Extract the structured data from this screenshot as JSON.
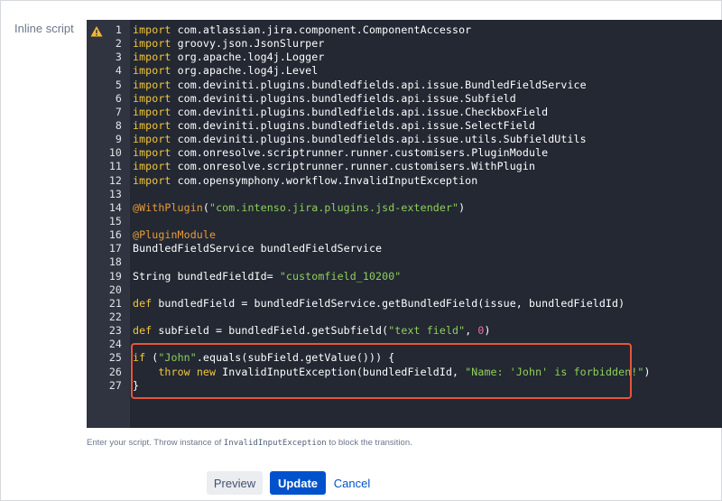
{
  "field": {
    "label": "Inline script"
  },
  "editor": {
    "warning_icon": "warning-triangle-icon",
    "lines": [
      {
        "n": "1",
        "parts": [
          {
            "t": "import",
            "c": "kw"
          },
          {
            "t": " com.atlassian.jira.component.ComponentAccessor",
            "c": ""
          }
        ]
      },
      {
        "n": "2",
        "parts": [
          {
            "t": "import",
            "c": "kw"
          },
          {
            "t": " groovy.json.JsonSlurper",
            "c": ""
          }
        ]
      },
      {
        "n": "3",
        "parts": [
          {
            "t": "import",
            "c": "kw"
          },
          {
            "t": " org.apache.log4j.Logger",
            "c": ""
          }
        ]
      },
      {
        "n": "4",
        "parts": [
          {
            "t": "import",
            "c": "kw"
          },
          {
            "t": " org.apache.log4j.Level",
            "c": ""
          }
        ]
      },
      {
        "n": "5",
        "parts": [
          {
            "t": "import",
            "c": "kw"
          },
          {
            "t": " com.deviniti.plugins.bundledfields.api.issue.BundledFieldService",
            "c": ""
          }
        ]
      },
      {
        "n": "6",
        "parts": [
          {
            "t": "import",
            "c": "kw"
          },
          {
            "t": " com.deviniti.plugins.bundledfields.api.issue.Subfield",
            "c": ""
          }
        ]
      },
      {
        "n": "7",
        "parts": [
          {
            "t": "import",
            "c": "kw"
          },
          {
            "t": " com.deviniti.plugins.bundledfields.api.issue.CheckboxField",
            "c": ""
          }
        ]
      },
      {
        "n": "8",
        "parts": [
          {
            "t": "import",
            "c": "kw"
          },
          {
            "t": " com.deviniti.plugins.bundledfields.api.issue.SelectField",
            "c": ""
          }
        ]
      },
      {
        "n": "9",
        "parts": [
          {
            "t": "import",
            "c": "kw"
          },
          {
            "t": " com.deviniti.plugins.bundledfields.api.issue.utils.SubfieldUtils",
            "c": ""
          }
        ]
      },
      {
        "n": "10",
        "parts": [
          {
            "t": "import",
            "c": "kw"
          },
          {
            "t": " com.onresolve.scriptrunner.runner.customisers.PluginModule",
            "c": ""
          }
        ]
      },
      {
        "n": "11",
        "parts": [
          {
            "t": "import",
            "c": "kw"
          },
          {
            "t": " com.onresolve.scriptrunner.runner.customisers.WithPlugin",
            "c": ""
          }
        ]
      },
      {
        "n": "12",
        "parts": [
          {
            "t": "import",
            "c": "kw"
          },
          {
            "t": " com.opensymphony.workflow.InvalidInputException",
            "c": ""
          }
        ]
      },
      {
        "n": "13",
        "parts": []
      },
      {
        "n": "14",
        "parts": [
          {
            "t": "@WithPlugin",
            "c": "ann"
          },
          {
            "t": "(",
            "c": ""
          },
          {
            "t": "\"com.intenso.jira.plugins.jsd-extender\"",
            "c": "str"
          },
          {
            "t": ")",
            "c": ""
          }
        ]
      },
      {
        "n": "15",
        "parts": []
      },
      {
        "n": "16",
        "parts": [
          {
            "t": "@PluginModule",
            "c": "ann"
          }
        ]
      },
      {
        "n": "17",
        "parts": [
          {
            "t": "BundledFieldService bundledFieldService",
            "c": ""
          }
        ]
      },
      {
        "n": "18",
        "parts": []
      },
      {
        "n": "19",
        "parts": [
          {
            "t": "String bundledFieldId= ",
            "c": ""
          },
          {
            "t": "\"customfield_10200\"",
            "c": "str"
          }
        ]
      },
      {
        "n": "20",
        "parts": []
      },
      {
        "n": "21",
        "parts": [
          {
            "t": "def",
            "c": "kw"
          },
          {
            "t": " bundledField = bundledFieldService.getBundledField(issue, bundledFieldId)",
            "c": ""
          }
        ]
      },
      {
        "n": "22",
        "parts": []
      },
      {
        "n": "23",
        "parts": [
          {
            "t": "def",
            "c": "kw"
          },
          {
            "t": " subField = bundledField.getSubfield(",
            "c": ""
          },
          {
            "t": "\"text field\"",
            "c": "str"
          },
          {
            "t": ", ",
            "c": ""
          },
          {
            "t": "0",
            "c": "num"
          },
          {
            "t": ")",
            "c": ""
          }
        ]
      },
      {
        "n": "24",
        "parts": []
      },
      {
        "n": "25",
        "parts": [
          {
            "t": "if",
            "c": "kw"
          },
          {
            "t": " (",
            "c": ""
          },
          {
            "t": "\"John\"",
            "c": "str"
          },
          {
            "t": ".equals(subField.getValue())) {",
            "c": ""
          }
        ]
      },
      {
        "n": "26",
        "parts": [
          {
            "t": "    ",
            "c": ""
          },
          {
            "t": "throw",
            "c": "kw"
          },
          {
            "t": " ",
            "c": ""
          },
          {
            "t": "new",
            "c": "kw"
          },
          {
            "t": " InvalidInputException(bundledFieldId, ",
            "c": ""
          },
          {
            "t": "\"Name: 'John' is forbidden!\"",
            "c": "str"
          },
          {
            "t": ")",
            "c": ""
          }
        ]
      },
      {
        "n": "27",
        "parts": [
          {
            "t": "}",
            "c": ""
          }
        ]
      }
    ]
  },
  "help": {
    "before": "Enter your script. Throw instance of ",
    "code": "InvalidInputException",
    "after": " to block the transition."
  },
  "actions": {
    "preview_label": "Preview",
    "update_label": "Update",
    "cancel_label": "Cancel"
  },
  "colors": {
    "editor_bg": "#232833",
    "keyword": "#f3c738",
    "string": "#8fd05a",
    "annotation": "#e89c3a",
    "number": "#f2709c",
    "highlight_border": "#e8553a",
    "primary_button": "#0052cc"
  }
}
